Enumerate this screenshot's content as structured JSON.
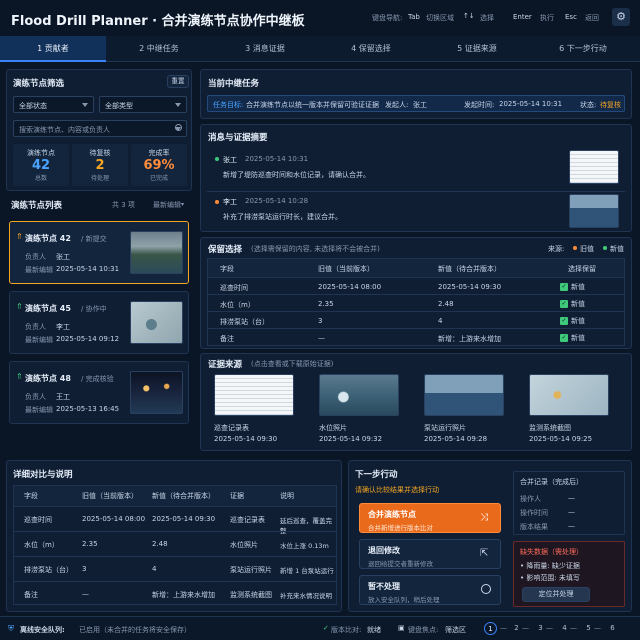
{
  "app_title": "Flood Drill Planner · 合并演练节点协作中继板",
  "shortcuts": [
    {
      "label": "键盘导航:",
      "key": "Tab",
      "desc": "切换区域"
    },
    {
      "key": "↑↓",
      "desc": "选择"
    },
    {
      "key": "Enter",
      "desc": "执行"
    },
    {
      "key": "Esc",
      "desc": "返回"
    }
  ],
  "tabs": [
    "1 贡献者",
    "2 中继任务",
    "3 消息证据",
    "4 保留选择",
    "5 证据来源",
    "6 下一步行动"
  ],
  "filter": {
    "title": "演练节点筛选",
    "reset": "重置",
    "status": "全部状态",
    "type": "全部类型",
    "search_placeholder": "搜索演练节点、内容或负责人"
  },
  "stats": [
    {
      "label": "演练节点",
      "value": "42",
      "sub": "总数",
      "color": "#4aa3ff"
    },
    {
      "label": "待复核",
      "value": "2",
      "sub": "待处理",
      "color": "#f5a623"
    },
    {
      "label": "完成率",
      "value": "69%",
      "sub": "已完成",
      "color": "#ff8c3a"
    }
  ],
  "node_list": {
    "title": "演练节点列表",
    "count": "共 3 项",
    "sort": "最新编辑"
  },
  "nodes": [
    {
      "name": "演练节点 42",
      "tag": "/ 新提交",
      "owner_label": "负责人",
      "owner": "张工",
      "edit_label": "最新编辑",
      "edit": "2025-05-14 10:31"
    },
    {
      "name": "演练节点 45",
      "tag": "/ 协作中",
      "owner_label": "负责人",
      "owner": "李工",
      "edit_label": "最新编辑",
      "edit": "2025-05-14 09:12"
    },
    {
      "name": "演练节点 48",
      "tag": "/ 完成核验",
      "owner_label": "负责人",
      "owner": "王工",
      "edit_label": "最新编辑",
      "edit": "2025-05-13 16:45"
    }
  ],
  "task": {
    "title": "当前中继任务",
    "goal_label": "任务目标:",
    "goal": "合并演练节点以统一版本并保留可验证证据",
    "initiator_label": "发起人:",
    "initiator": "张工",
    "time_label": "发起时间:",
    "time": "2025-05-14 10:31",
    "status_label": "状态:",
    "status": "待复核"
  },
  "messages": {
    "title": "消息与证据摘要",
    "items": [
      {
        "author": "张工",
        "time": "2025-05-14 10:31",
        "text": "新增了堤防巡查时间和水位记录，请确认合并。"
      },
      {
        "author": "李工",
        "time": "2025-05-14 10:28",
        "text": "补充了排涝泵站运行时长，建议合并。"
      }
    ]
  },
  "keep": {
    "title": "保留选择",
    "hint": "(选择需保留的内容, 未选择将不会被合并)",
    "source_label": "来源:",
    "old_label": "旧值",
    "new_label": "新值",
    "headers": [
      "字段",
      "旧值（当前版本）",
      "新值（待合并版本）",
      "选择保留"
    ],
    "rows": [
      [
        "巡查时间",
        "2025-05-14 08:00",
        "2025-05-14 09:30",
        "新值"
      ],
      [
        "水位（m）",
        "2.35",
        "2.48",
        "新值"
      ],
      [
        "排涝泵站（台）",
        "3",
        "4",
        "新值"
      ],
      [
        "备注",
        "—",
        "新增：上游来水增加",
        "新值"
      ]
    ]
  },
  "evidence": {
    "title": "证据来源",
    "hint": "(点击查看或下载原始证据)",
    "items": [
      {
        "name": "巡查记录表",
        "time": "2025-05-14 09:30"
      },
      {
        "name": "水位照片",
        "time": "2025-05-14 09:32"
      },
      {
        "name": "泵站运行照片",
        "time": "2025-05-14 09:28"
      },
      {
        "name": "监测系统截图",
        "time": "2025-05-14 09:25"
      }
    ]
  },
  "detail": {
    "title": "详细对比与说明",
    "headers": [
      "字段",
      "旧值（当前版本）",
      "新值（待合并版本）",
      "证据",
      "说明"
    ],
    "rows": [
      [
        "巡查时间",
        "2025-05-14 08:00",
        "2025-05-14 09:30",
        "巡查记录表",
        "延后巡查，覆盖完整"
      ],
      [
        "水位（m）",
        "2.35",
        "2.48",
        "水位照片",
        "水位上涨 0.13m"
      ],
      [
        "排涝泵站（台）",
        "3",
        "4",
        "泵站运行照片",
        "新增 1 台泵站运行"
      ],
      [
        "备注",
        "—",
        "新增：上游来水增加",
        "监测系统截图",
        "补充来水情况说明"
      ]
    ]
  },
  "next": {
    "title": "下一步行动",
    "hint": "请确认比较结果并选择行动",
    "actions": [
      {
        "title": "合并演练节点",
        "sub": "合并新增进行版本比对"
      },
      {
        "title": "退回修改",
        "sub": "退回给提交者重新修改"
      },
      {
        "title": "暂不处理",
        "sub": "放入安全队列，稍后处理"
      }
    ]
  },
  "record": {
    "title": "合并记录（完成后）",
    "rows": [
      [
        "操作人",
        "—"
      ],
      [
        "操作时间",
        "—"
      ],
      [
        "版本结果",
        "—"
      ]
    ]
  },
  "missing": {
    "title": "缺失数据（需处理）",
    "items": [
      "• 降雨量: 缺少证据",
      "• 影响范围: 未填写"
    ],
    "button": "定位并处理"
  },
  "footer": {
    "queue_label": "离线安全队列:",
    "queue": "已启用（未合并的任务将安全保存）",
    "compare_label": "版本比对:",
    "compare": "就绪",
    "focus_label": "键盘焦点:",
    "focus": "筛选区",
    "pages": [
      "1",
      "2",
      "3",
      "4",
      "5",
      "6"
    ]
  },
  "colors": {
    "accent": "#3b82f6",
    "orange": "#ff8c3a",
    "ok": "#3fc97a",
    "warn": "#f5a623"
  }
}
